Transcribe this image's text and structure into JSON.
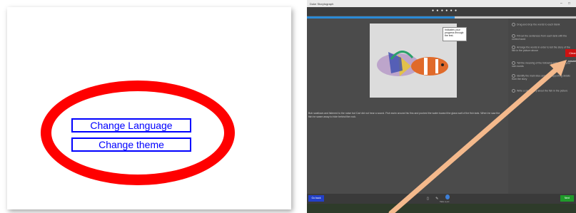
{
  "left_panel": {
    "buttons": [
      {
        "label": "Change Language"
      },
      {
        "label": "Change theme"
      }
    ],
    "highlight_color": "#ff0000",
    "button_color": "#0000ff"
  },
  "app": {
    "window_title": "Duke Storytograph",
    "window_controls": [
      "–",
      "□"
    ],
    "step_dots": "● ● ● ● ● ●",
    "progress": 0.55,
    "tooltip_text": "Indicates your progress through the test.",
    "story_text": "Bob swallows and listened to the noise but Carl did not hear a sound. Fish swim around his fins and pushed the water toward the glass wall of the fish tank. When he saw the fish he swam away to hide behind the rock.",
    "side_items": [
      "Drag and drop the words to each blank",
      "Fill out the sentences from each tank with the correct word",
      "Arrange the words in order to tell the story of the fish in the picture above",
      "Tell the meaning of the following passage in your own words",
      "Identify the main idea and two supporting details from the story",
      "Write a short story about the fish in the picture"
    ],
    "clear_button": "Clear answer",
    "left_bottom_button": "Go back",
    "right_bottom_button": "Next",
    "mid_label": "Take a pic"
  },
  "colors": {
    "accent_red": "#cc1111",
    "accent_green": "#1f9a2a",
    "accent_blue": "#2340c8",
    "arrow": "#f4b98c"
  }
}
